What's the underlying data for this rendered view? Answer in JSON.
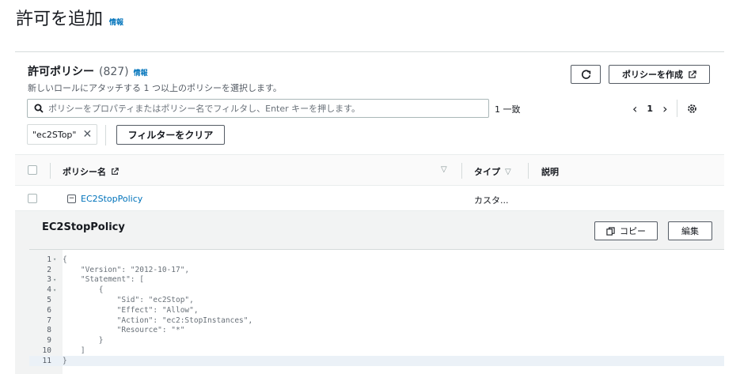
{
  "page": {
    "title": "許可を追加",
    "info": "情報"
  },
  "panel": {
    "title": "許可ポリシー",
    "count": "(827)",
    "info": "情報",
    "description": "新しいロールにアタッチする 1 つ以上のポリシーを選択します。",
    "create_button": "ポリシーを作成",
    "search_placeholder": "ポリシーをプロパティまたはポリシー名でフィルタし、Enter キーを押します。",
    "match_count": "1 一致",
    "page_number": "1",
    "filter_token": "\"ec2STop\"",
    "clear_filter_button": "フィルターをクリア"
  },
  "table": {
    "columns": [
      "ポリシー名",
      "タイプ",
      "説明"
    ],
    "rows": [
      {
        "name": "EC2StopPolicy",
        "type": "カスタ...",
        "description": ""
      }
    ]
  },
  "detail": {
    "title": "EC2StopPolicy",
    "copy_button": "コピー",
    "edit_button": "編集",
    "code_lines": [
      "{",
      "    \"Version\": \"2012-10-17\",",
      "    \"Statement\": [",
      "        {",
      "            \"Sid\": \"ec2Stop\",",
      "            \"Effect\": \"Allow\",",
      "            \"Action\": \"ec2:StopInstances\",",
      "            \"Resource\": \"*\"",
      "        }",
      "    ]",
      "}"
    ],
    "line_numbers": [
      "1",
      "2",
      "3",
      "4",
      "5",
      "6",
      "7",
      "8",
      "9",
      "10",
      "11"
    ],
    "fold_markers": [
      "▾",
      "",
      "▾",
      "▾",
      "",
      "",
      "",
      "",
      "",
      "",
      ""
    ]
  },
  "colors": {
    "link": "#0073bb",
    "text": "#16191f",
    "muted": "#545b64"
  }
}
